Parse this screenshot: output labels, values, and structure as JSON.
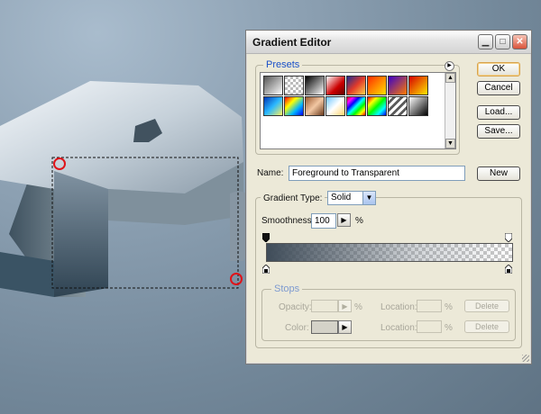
{
  "dialog": {
    "title": "Gradient Editor",
    "presets_label": "Presets",
    "buttons": {
      "ok": "OK",
      "cancel": "Cancel",
      "load": "Load...",
      "save": "Save...",
      "new": "New"
    },
    "name_label": "Name:",
    "name_value": "Foreground to Transparent",
    "gradient_type_label": "Gradient Type:",
    "gradient_type_value": "Solid",
    "smoothness_label": "Smoothness:",
    "smoothness_value": "100",
    "smoothness_unit": "%",
    "stops": {
      "label": "Stops",
      "opacity_label": "Opacity:",
      "opacity_unit": "%",
      "color_label": "Color:",
      "location_label": "Location:",
      "location_unit": "%",
      "delete_label": "Delete"
    }
  },
  "preset_swatches": [
    "linear-gradient(135deg,#555,#fff)",
    "repeating-conic-gradient(#fff 0 25%,#bbb 0 50%) 0 0/6px 6px",
    "linear-gradient(135deg,#000,#fff)",
    "linear-gradient(135deg,#ffffff,#cc0000 60%,#660000)",
    "linear-gradient(135deg,#1d2c8f,#e23a2a,#ffd34a)",
    "linear-gradient(135deg,#ff2a00,#ff8800,#ffe000)",
    "linear-gradient(135deg,#3a00c8,#ff7a00)",
    "linear-gradient(135deg,#d60000,#ffe600)",
    "linear-gradient(135deg,#0035b5,#2bb8ff,#fff35c)",
    "linear-gradient(135deg,#ff0000,#ffff00,#00b7ff,#0000ff)",
    "linear-gradient(135deg,#9b5b31,#f2c7a3,#6a3a1c)",
    "linear-gradient(135deg,#6ec6ff,#ffffff,#ffd66e)",
    "linear-gradient(135deg,#ff0000,#ff00ff,#0000ff,#00ffff,#00ff00,#ffff00,#ff0000)",
    "linear-gradient(135deg,#ff0000,#ffff00,#00ff00,#00ffff,#0000ff)",
    "repeating-linear-gradient(135deg,#ffffff 0 3px,#5a5a5a 3px 6px)",
    "linear-gradient(135deg,#ffffff,#000000)"
  ],
  "gradient": {
    "foreground_color": "#3f4c59",
    "stop_color": "#c9c9c9"
  },
  "canvas": {
    "selection_color": "#ff0000",
    "letter_color": "#9aa8b4"
  }
}
